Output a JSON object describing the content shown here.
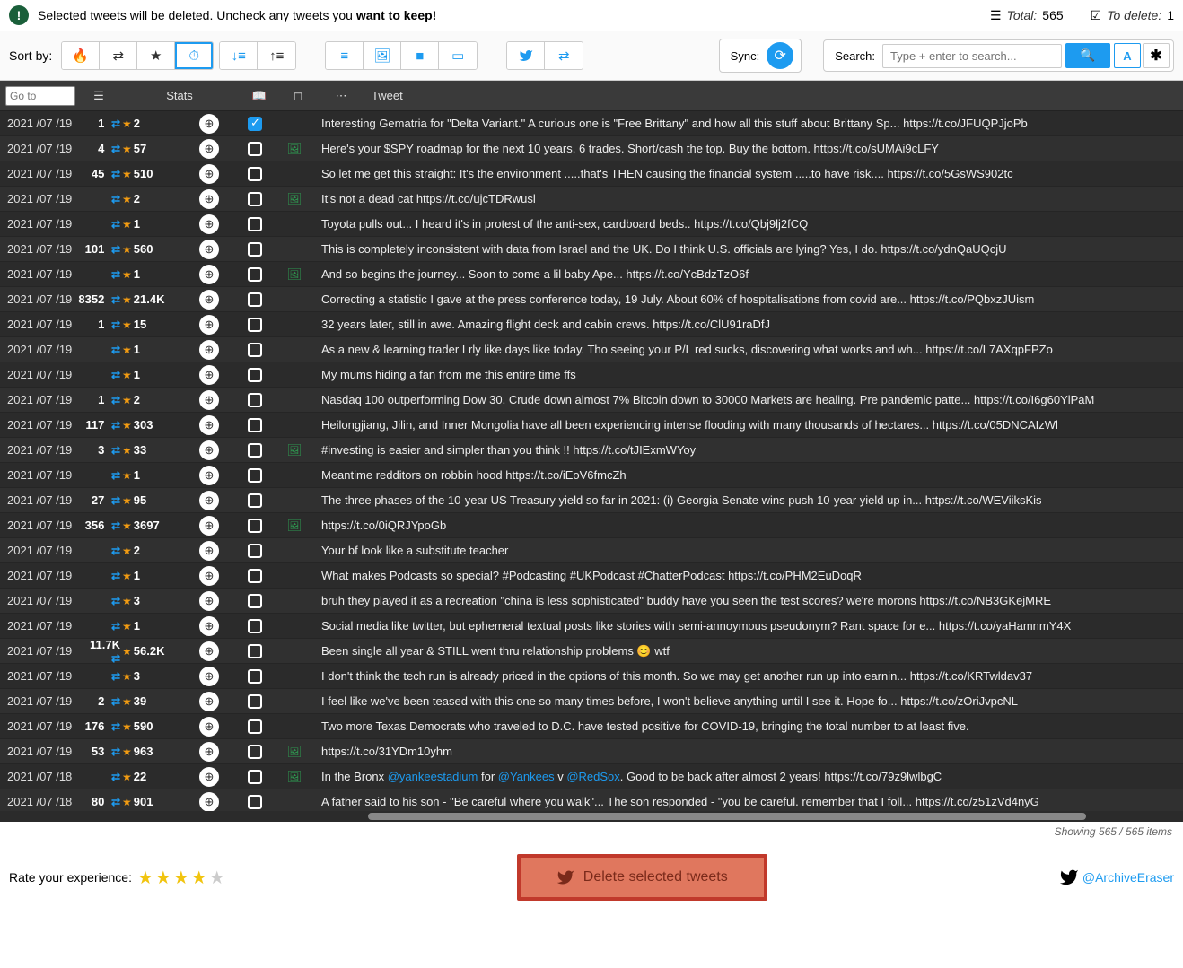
{
  "header": {
    "message_pre": "Selected tweets will be deleted. Uncheck any tweets you ",
    "message_bold": "want to keep!",
    "total_label": "Total",
    "total_value": "565",
    "delete_label": "To delete",
    "delete_value": "1"
  },
  "toolbar": {
    "sort_label": "Sort by:",
    "sync_label": "Sync:",
    "search_label": "Search:",
    "search_placeholder": "Type + enter to search...",
    "toggle_text": "A"
  },
  "table": {
    "goto_placeholder": "Go to",
    "stats_header": "Stats",
    "tweet_header": "Tweet"
  },
  "rows": [
    {
      "date": "2021 /07 /19",
      "rt": "1",
      "fav": "2",
      "checked": true,
      "media": false,
      "text": "Interesting Gematria for \"Delta Variant.\" A curious one is \"Free Brittany\" and how all this stuff about Brittany Sp... https://t.co/JFUQPJjoPb"
    },
    {
      "date": "2021 /07 /19",
      "rt": "4",
      "fav": "57",
      "checked": false,
      "media": true,
      "text": "Here's your $SPY roadmap for the next 10 years. 6 trades. Short/cash the top. Buy the bottom. https://t.co/sUMAi9cLFY"
    },
    {
      "date": "2021 /07 /19",
      "rt": "45",
      "fav": "510",
      "checked": false,
      "media": false,
      "text": "So let me get this straight: It's the environment .....that's THEN causing the financial system .....to have risk.... https://t.co/5GsWS902tc"
    },
    {
      "date": "2021 /07 /19",
      "rt": "",
      "fav": "2",
      "checked": false,
      "media": true,
      "text": "It's not a dead cat https://t.co/ujcTDRwusl"
    },
    {
      "date": "2021 /07 /19",
      "rt": "",
      "fav": "1",
      "checked": false,
      "media": false,
      "text": "Toyota pulls out... I heard it's in protest of the anti-sex, cardboard beds.. https://t.co/Qbj9lj2fCQ"
    },
    {
      "date": "2021 /07 /19",
      "rt": "101",
      "fav": "560",
      "checked": false,
      "media": false,
      "text": "This is completely inconsistent with data from Israel and the UK. Do I think U.S. officials are lying? Yes, I do. https://t.co/ydnQaUQcjU"
    },
    {
      "date": "2021 /07 /19",
      "rt": "",
      "fav": "1",
      "checked": false,
      "media": true,
      "text": "And so begins the journey... Soon to come a lil baby Ape... https://t.co/YcBdzTzO6f"
    },
    {
      "date": "2021 /07 /19",
      "rt": "8352",
      "fav": "21.4K",
      "checked": false,
      "media": false,
      "text": "Correcting a statistic I gave at the press conference today, 19 July. About 60% of hospitalisations from covid are... https://t.co/PQbxzJUism"
    },
    {
      "date": "2021 /07 /19",
      "rt": "1",
      "fav": "15",
      "checked": false,
      "media": false,
      "text": "32 years later, still in awe. Amazing flight deck and cabin crews. https://t.co/ClU91raDfJ"
    },
    {
      "date": "2021 /07 /19",
      "rt": "",
      "fav": "1",
      "checked": false,
      "media": false,
      "text": "As a new & learning trader I rly like days like today. Tho seeing your P/L red sucks, discovering what works and wh... https://t.co/L7AXqpFPZo"
    },
    {
      "date": "2021 /07 /19",
      "rt": "",
      "fav": "1",
      "checked": false,
      "media": false,
      "text": "My mums hiding a fan from me this entire time ffs"
    },
    {
      "date": "2021 /07 /19",
      "rt": "1",
      "fav": "2",
      "checked": false,
      "media": false,
      "text": "Nasdaq 100 outperforming Dow 30. Crude down almost 7% Bitcoin down to 30000 Markets are healing. Pre pandemic patte... https://t.co/I6g60YlPaM"
    },
    {
      "date": "2021 /07 /19",
      "rt": "117",
      "fav": "303",
      "checked": false,
      "media": false,
      "text": "Heilongjiang, Jilin, and Inner Mongolia have all been experiencing intense flooding with many thousands of hectares... https://t.co/05DNCAIzWl"
    },
    {
      "date": "2021 /07 /19",
      "rt": "3",
      "fav": "33",
      "checked": false,
      "media": true,
      "text": "#investing is easier and simpler than you think !! https://t.co/tJIExmWYoy"
    },
    {
      "date": "2021 /07 /19",
      "rt": "",
      "fav": "1",
      "checked": false,
      "media": false,
      "text": "Meantime redditors on robbin hood https://t.co/iEoV6fmcZh"
    },
    {
      "date": "2021 /07 /19",
      "rt": "27",
      "fav": "95",
      "checked": false,
      "media": false,
      "text": "The three phases of the 10-year US Treasury yield so far in 2021: (i) Georgia Senate wins push 10-year yield up in... https://t.co/WEViiksKis"
    },
    {
      "date": "2021 /07 /19",
      "rt": "356",
      "fav": "3697",
      "checked": false,
      "media": true,
      "text": "https://t.co/0iQRJYpoGb"
    },
    {
      "date": "2021 /07 /19",
      "rt": "",
      "fav": "2",
      "checked": false,
      "media": false,
      "text": "Your bf look like a substitute teacher"
    },
    {
      "date": "2021 /07 /19",
      "rt": "",
      "fav": "1",
      "checked": false,
      "media": false,
      "text": "What makes Podcasts so special? #Podcasting #UKPodcast #ChatterPodcast https://t.co/PHM2EuDoqR"
    },
    {
      "date": "2021 /07 /19",
      "rt": "",
      "fav": "3",
      "checked": false,
      "media": false,
      "text": "bruh they played it as a recreation \"china is less sophisticated\" buddy have you seen the test scores? we're morons https://t.co/NB3GKejMRE"
    },
    {
      "date": "2021 /07 /19",
      "rt": "",
      "fav": "1",
      "checked": false,
      "media": false,
      "text": "Social media like twitter, but ephemeral textual posts like stories with semi-annoymous pseudonym? Rant space for e... https://t.co/yaHamnmY4X"
    },
    {
      "date": "2021 /07 /19",
      "rt": "11.7K",
      "fav": "56.2K",
      "checked": false,
      "media": false,
      "text": "Been single all year & STILL went thru relationship problems 😊 wtf"
    },
    {
      "date": "2021 /07 /19",
      "rt": "",
      "fav": "3",
      "checked": false,
      "media": false,
      "text": "I don't think the tech run is already priced in the options of this month. So we may get another run up into earnin... https://t.co/KRTwldav37"
    },
    {
      "date": "2021 /07 /19",
      "rt": "2",
      "fav": "39",
      "checked": false,
      "media": false,
      "text": "I feel like we've been teased with this one so many times before, I won't believe anything until I see it. Hope fo... https://t.co/zOriJvpcNL"
    },
    {
      "date": "2021 /07 /19",
      "rt": "176",
      "fav": "590",
      "checked": false,
      "media": false,
      "text": "Two more Texas Democrats who traveled to D.C. have tested positive for COVID-19, bringing the total number to at least five."
    },
    {
      "date": "2021 /07 /19",
      "rt": "53",
      "fav": "963",
      "checked": false,
      "media": true,
      "text": "https://t.co/31YDm10yhm"
    },
    {
      "date": "2021 /07 /18",
      "rt": "",
      "fav": "22",
      "checked": false,
      "media": true,
      "text": "In the Bronx <span class='link'>@yankeestadium</span> for <span class='link'>@Yankees</span> v <span class='link'>@RedSox</span>. Good to be back after almost 2 years! https://t.co/79z9lwlbgC"
    },
    {
      "date": "2021 /07 /18",
      "rt": "80",
      "fav": "901",
      "checked": false,
      "media": false,
      "text": "A father said to his son - \"Be careful where you walk\"... The son responded - \"you be careful. remember that I foll... https://t.co/z51zVd4nyG"
    }
  ],
  "status": "Showing 565 / 565 items",
  "footer": {
    "rate_label": "Rate your experience:",
    "delete_button": "Delete selected tweets",
    "twitter_handle": "@ArchiveEraser"
  }
}
